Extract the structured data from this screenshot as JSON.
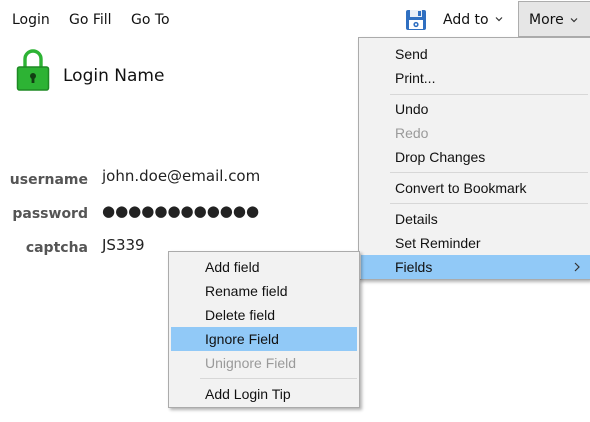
{
  "toolbar": {
    "login": "Login",
    "go_fill": "Go Fill",
    "go_to": "Go To",
    "save_icon": "save-disk-icon",
    "add_to": "Add to",
    "more": "More"
  },
  "record": {
    "title": "Login Name",
    "icon": "lock-icon",
    "icon_color": "#2db334"
  },
  "fields": {
    "username": {
      "label": "username",
      "value": "john.doe@email.com"
    },
    "password": {
      "label": "password",
      "value": "●●●●●●●●●●●●"
    },
    "captcha": {
      "label": "captcha",
      "value": "JS339"
    }
  },
  "more_menu": {
    "items": [
      {
        "label": "Send",
        "disabled": false
      },
      {
        "label": "Print...",
        "disabled": false
      },
      {
        "label": "Undo",
        "disabled": false
      },
      {
        "label": "Redo",
        "disabled": true
      },
      {
        "label": "Drop Changes",
        "disabled": false
      },
      {
        "label": "Convert to Bookmark",
        "disabled": false
      },
      {
        "label": "Details",
        "disabled": false
      },
      {
        "label": "Set Reminder",
        "disabled": false
      },
      {
        "label": "Fields",
        "disabled": false,
        "highlighted": true,
        "has_submenu": true
      }
    ]
  },
  "fields_menu": {
    "items": [
      {
        "label": "Add field",
        "disabled": false
      },
      {
        "label": "Rename field",
        "disabled": false
      },
      {
        "label": "Delete field",
        "disabled": false
      },
      {
        "label": "Ignore Field",
        "disabled": false,
        "highlighted": true
      },
      {
        "label": "Unignore Field",
        "disabled": true
      },
      {
        "label": "Add Login Tip",
        "disabled": false
      }
    ]
  },
  "colors": {
    "highlight": "#91c9f7",
    "menu_bg": "#f2f2f2",
    "label_gray": "#555555",
    "disabled_text": "#9a9a9a",
    "lock_green": "#2db334"
  }
}
